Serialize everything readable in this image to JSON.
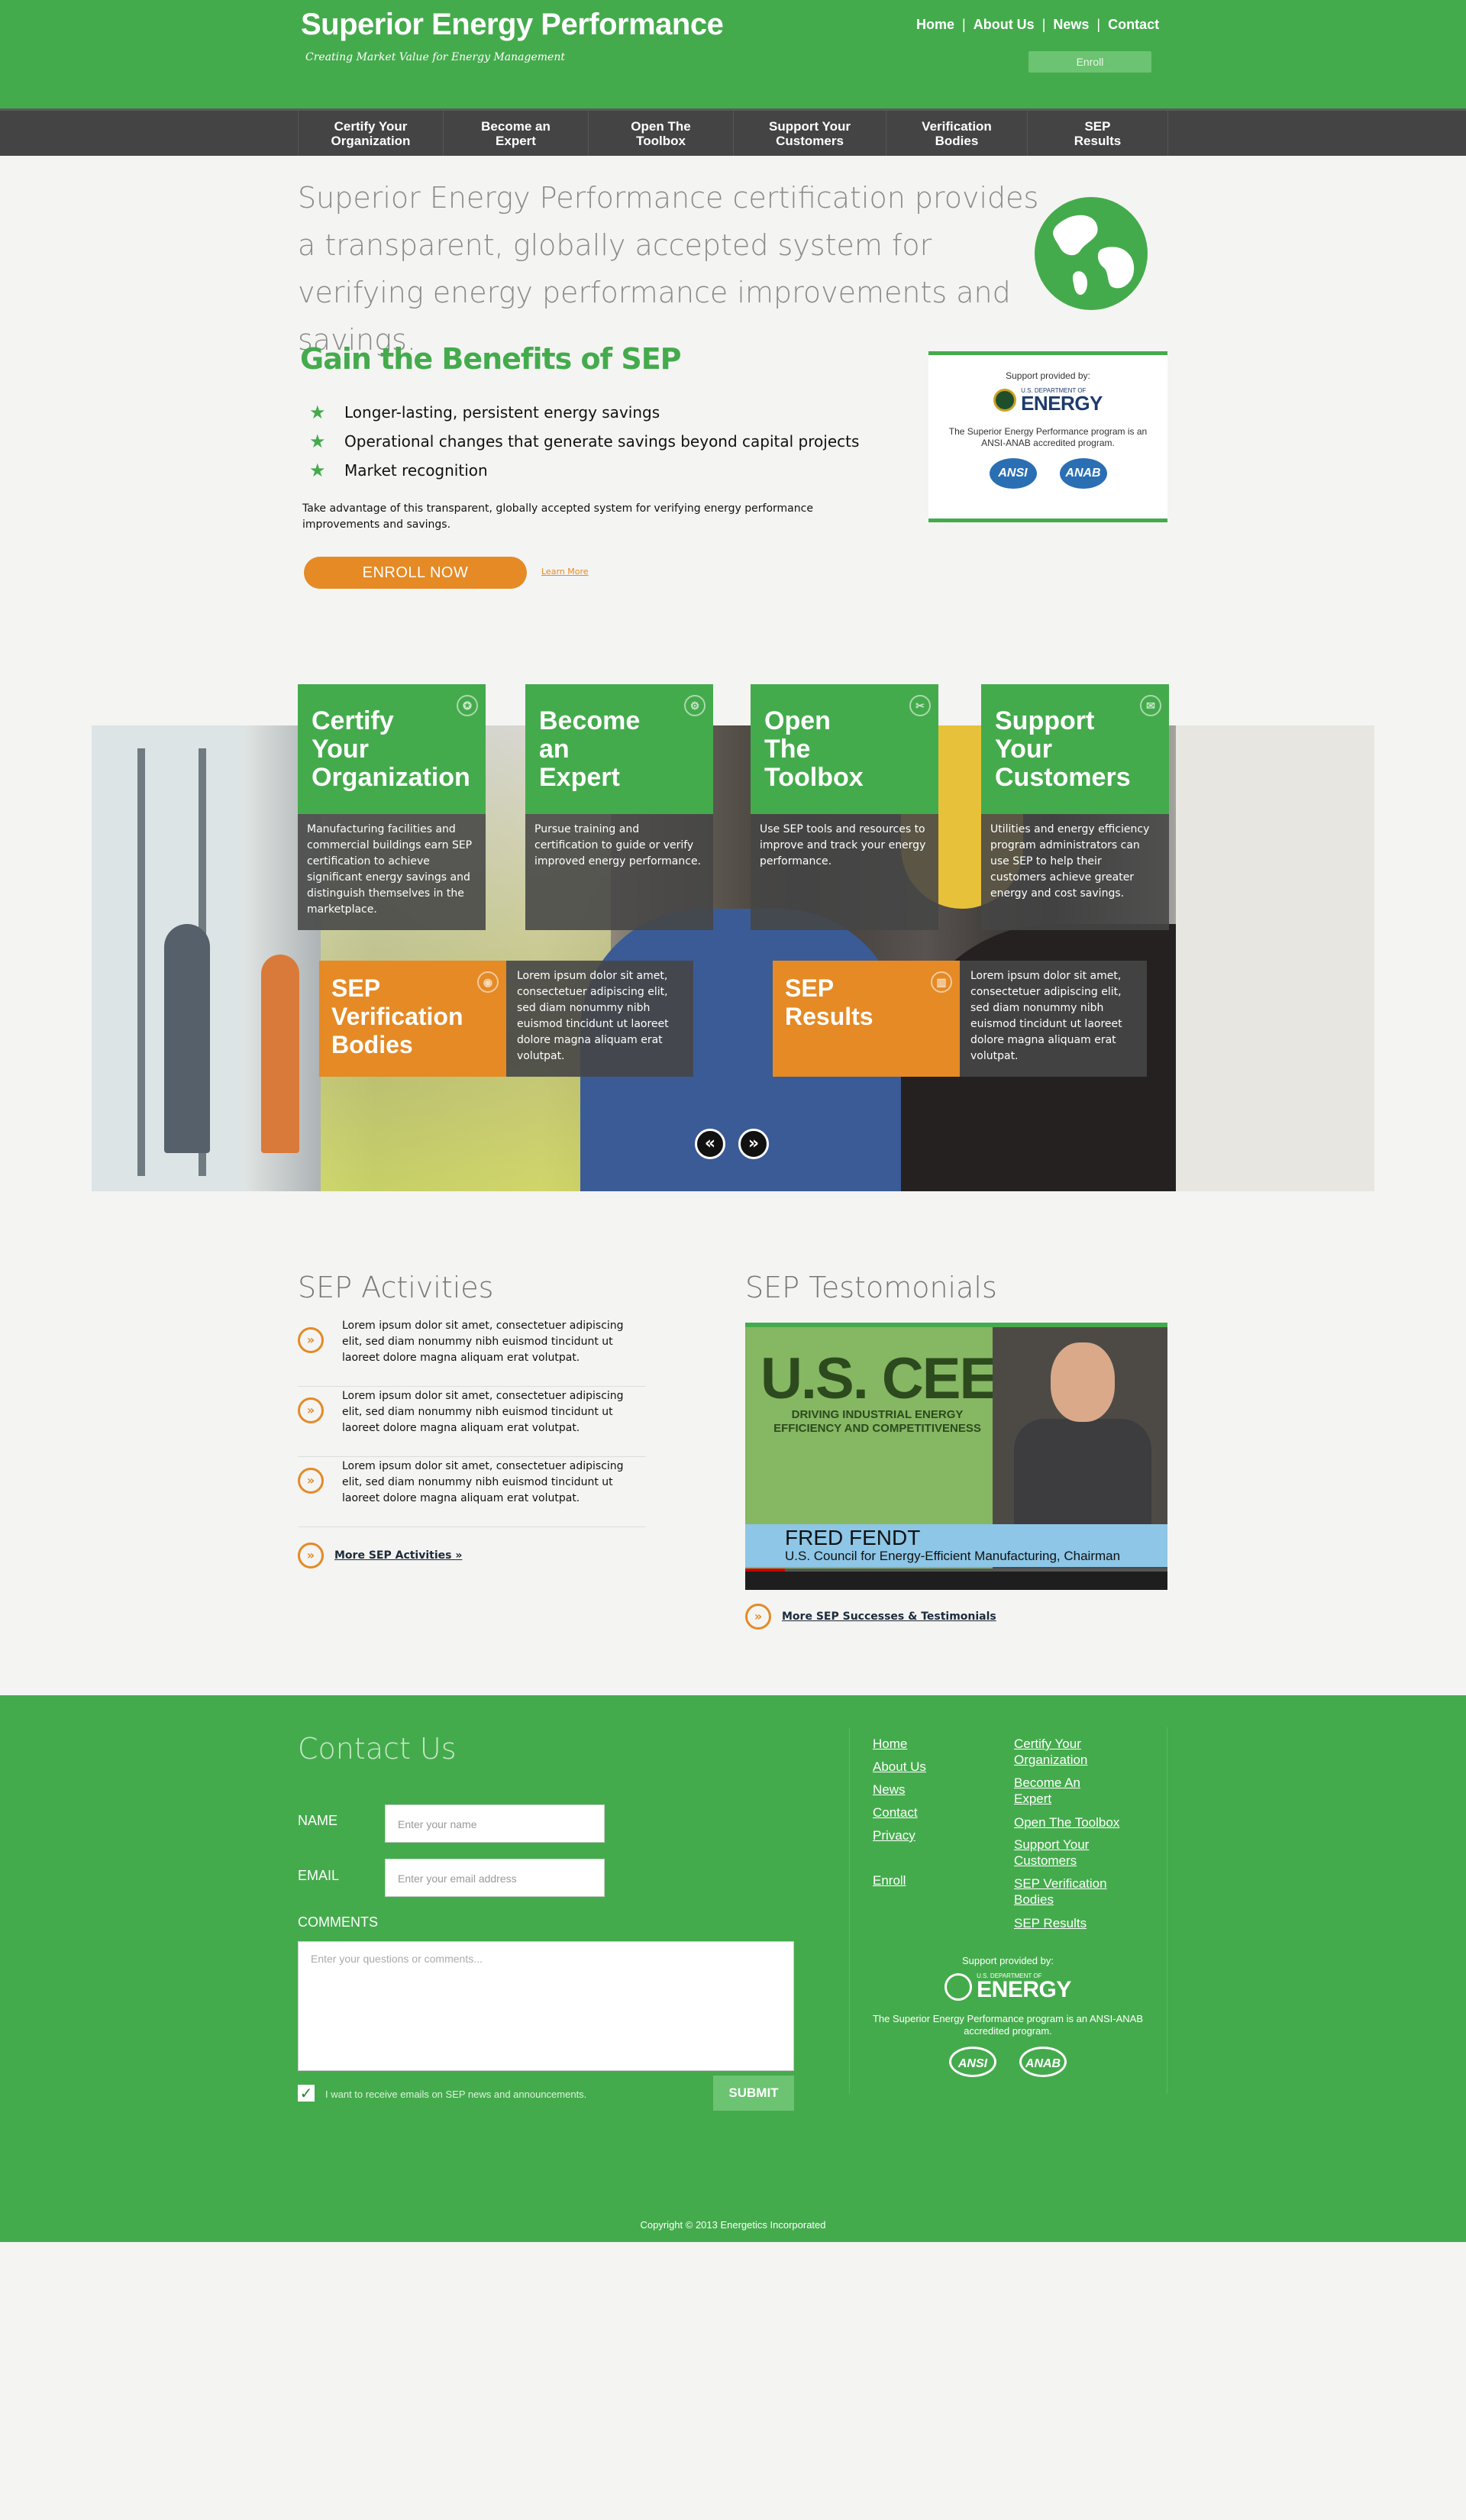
{
  "colors": {
    "brand_green": "#44ab4c",
    "accent_orange": "#e58a25",
    "nav_dark": "#444444"
  },
  "header": {
    "title": "Superior Energy Performance",
    "tagline": "Creating Market Value for Energy Management",
    "topnav": [
      "Home",
      "About Us",
      "News",
      "Contact"
    ],
    "enroll_label": "Enroll"
  },
  "mainnav": [
    "Certify Your\nOrganization",
    "Become an\nExpert",
    "Open The\nToolbox",
    "Support Your\nCustomers",
    "Verification\nBodies",
    "SEP\nResults"
  ],
  "intro": {
    "text": "Superior Energy Performance certification provides a transparent, globally accepted system for verifying energy performance improvements and savings.",
    "globe_icon": "globe-icon"
  },
  "benefits": {
    "title": "Gain the Benefits of SEP",
    "items": [
      "Longer-lasting, persistent energy savings",
      "Operational changes that generate savings beyond capital projects",
      "Market recognition"
    ],
    "description": "Take advantage of this transparent, globally accepted system for verifying energy performance improvements and savings.",
    "enroll_now": "ENROLL NOW",
    "learn_more": "Learn More"
  },
  "support_box": {
    "label": "Support provided by:",
    "doe_small": "U.S. DEPARTMENT OF",
    "doe_big": "ENERGY",
    "accreditation": "The Superior Energy Performance program is an ANSI-ANAB accredited program.",
    "logos": [
      "ANSI",
      "ANAB"
    ]
  },
  "slider": {
    "cards": [
      {
        "title": "Certify\nYour\nOrganization",
        "text": "Manufacturing facilities and commercial buildings earn SEP certification to achieve significant energy savings and distinguish themselves in the marketplace.",
        "icon": "star-badge-icon"
      },
      {
        "title": "Become\nan\nExpert",
        "text": "Pursue training and certification to guide or verify improved energy performance.",
        "icon": "gear-icon"
      },
      {
        "title": "Open\nThe\nToolbox",
        "text": "Use SEP tools and resources to improve  and track your energy performance.",
        "icon": "wrench-icon"
      },
      {
        "title": "Support\nYour\nCustomers",
        "text": "Utilities and energy efficiency program administrators can use SEP to help their customers achieve greater energy and cost savings.",
        "icon": "chat-icon"
      }
    ],
    "cards2": [
      {
        "title": "SEP\nVerification\nBodies",
        "text": "Lorem ipsum dolor sit amet, consectetuer adipiscing elit, sed diam nonummy nibh euismod tincidunt ut laoreet dolore magna aliquam erat volutpat.",
        "icon": "eye-icon"
      },
      {
        "title": "SEP\nResults",
        "text": "Lorem ipsum dolor sit amet, consectetuer adipiscing elit, sed diam nonummy nibh euismod tincidunt ut laoreet dolore magna aliquam erat volutpat.",
        "icon": "chart-icon"
      }
    ],
    "prev": "«",
    "next": "»"
  },
  "activities": {
    "title": "SEP Activities",
    "items": [
      "Lorem ipsum dolor sit amet, consectetuer adipiscing elit, sed diam nonummy nibh euismod tincidunt ut laoreet dolore magna aliquam erat volutpat.",
      "Lorem ipsum dolor sit amet, consectetuer adipiscing elit, sed diam nonummy nibh euismod tincidunt ut laoreet dolore magna aliquam erat volutpat.",
      "Lorem ipsum dolor sit amet, consectetuer adipiscing elit, sed diam nonummy nibh euismod tincidunt ut laoreet dolore magna aliquam erat volutpat."
    ],
    "more": "More SEP Activities »",
    "icon": "»"
  },
  "testimonials": {
    "title": "SEP Testomonials",
    "video": {
      "headline": "U.S. CEEM",
      "subhead": "DRIVING INDUSTRIAL ENERGY EFFICIENCY AND COMPETITIVENESS",
      "name": "FRED FENDT",
      "org": "U.S. Council for Energy-Efficient Manufacturing, Chairman"
    },
    "more": "More SEP Successes & Testimonials"
  },
  "contact": {
    "title": "Contact Us",
    "name_label": "NAME",
    "name_placeholder": "Enter your name",
    "email_label": "EMAIL",
    "email_placeholder": "Enter your email address",
    "comments_label": "COMMENTS",
    "comments_placeholder": "Enter your questions or comments...",
    "checkbox_label": "I want to receive emails on SEP news and announcements.",
    "checkbox_mark": "✓",
    "submit": "SUBMIT"
  },
  "footer": {
    "links_col1": [
      "Home",
      "About Us",
      "News",
      "Contact",
      "Privacy",
      "Enroll"
    ],
    "links_col2": [
      "Certify Your\nOrganization",
      "Become An\nExpert",
      "Open The Toolbox",
      "Support Your\nCustomers",
      "SEP Verification\nBodies",
      "SEP Results"
    ],
    "support_label": "Support provided by:",
    "doe_small": "U.S. DEPARTMENT OF",
    "doe_big": "ENERGY",
    "accreditation": "The Superior Energy Performance program is an ANSI-ANAB accredited program.",
    "logos": [
      "ANSI",
      "ANAB"
    ],
    "copyright": "Copyright © 2013 Energetics Incorporated"
  }
}
